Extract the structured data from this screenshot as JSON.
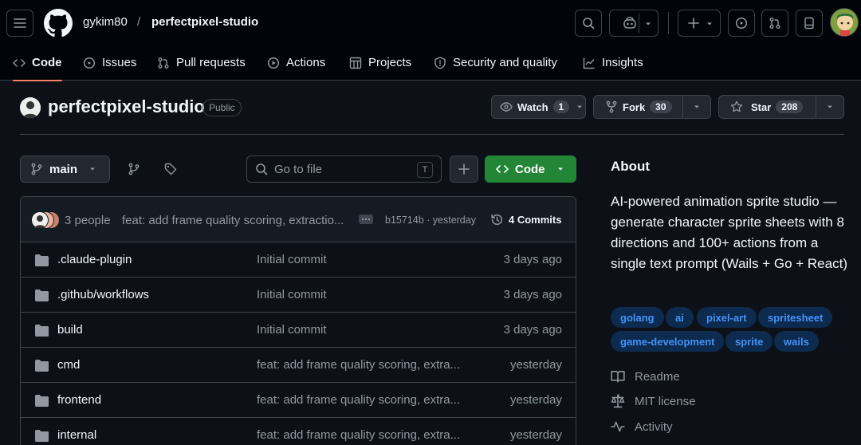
{
  "header": {
    "owner": "gykim80",
    "separator": "/",
    "repo": "perfectpixel-studio"
  },
  "tabs": [
    {
      "label": "Code",
      "icon": "code-icon"
    },
    {
      "label": "Issues",
      "icon": "issue-icon"
    },
    {
      "label": "Pull requests",
      "icon": "pull-request-icon"
    },
    {
      "label": "Actions",
      "icon": "play-icon"
    },
    {
      "label": "Projects",
      "icon": "table-icon"
    },
    {
      "label": "Security and quality",
      "icon": "shield-icon"
    },
    {
      "label": "Insights",
      "icon": "graph-icon"
    }
  ],
  "repo": {
    "title": "perfectpixel-studio",
    "visibility": "Public",
    "watch_label": "Watch",
    "watch_count": "1",
    "fork_label": "Fork",
    "fork_count": "30",
    "star_label": "Star",
    "star_count": "208"
  },
  "toolbar": {
    "branch": "main",
    "goto_placeholder": "Go to file",
    "goto_shortcut": "T",
    "code_label": "Code"
  },
  "commit": {
    "people": "3 people",
    "message": "feat: add frame quality scoring, extractio...",
    "hash": "b15714b · yesterday",
    "commits": "4 Commits"
  },
  "files": [
    {
      "name": ".claude-plugin",
      "message": "Initial commit",
      "date": "3 days ago"
    },
    {
      "name": ".github/workflows",
      "message": "Initial commit",
      "date": "3 days ago"
    },
    {
      "name": "build",
      "message": "Initial commit",
      "date": "3 days ago"
    },
    {
      "name": "cmd",
      "message": "feat: add frame quality scoring, extra...",
      "date": "yesterday"
    },
    {
      "name": "frontend",
      "message": "feat: add frame quality scoring, extra...",
      "date": "yesterday"
    },
    {
      "name": "internal",
      "message": "feat: add frame quality scoring, extra...",
      "date": "yesterday"
    }
  ],
  "about": {
    "heading": "About",
    "description": "AI-powered animation sprite studio — generate character sprite sheets with 8 directions and 100+ actions from a single text prompt (Wails + Go + React)",
    "topics": [
      "golang",
      "ai",
      "pixel-art",
      "spritesheet",
      "game-development",
      "sprite",
      "wails"
    ],
    "links": [
      {
        "label": "Readme",
        "icon": "book-icon"
      },
      {
        "label": "MIT license",
        "icon": "law-icon"
      },
      {
        "label": "Activity",
        "icon": "pulse-icon"
      }
    ]
  },
  "colors": {
    "accent_tab": "#f78166",
    "code_button": "#238636",
    "topic_bg": "#0d2a4f",
    "topic_fg": "#4493f8"
  }
}
